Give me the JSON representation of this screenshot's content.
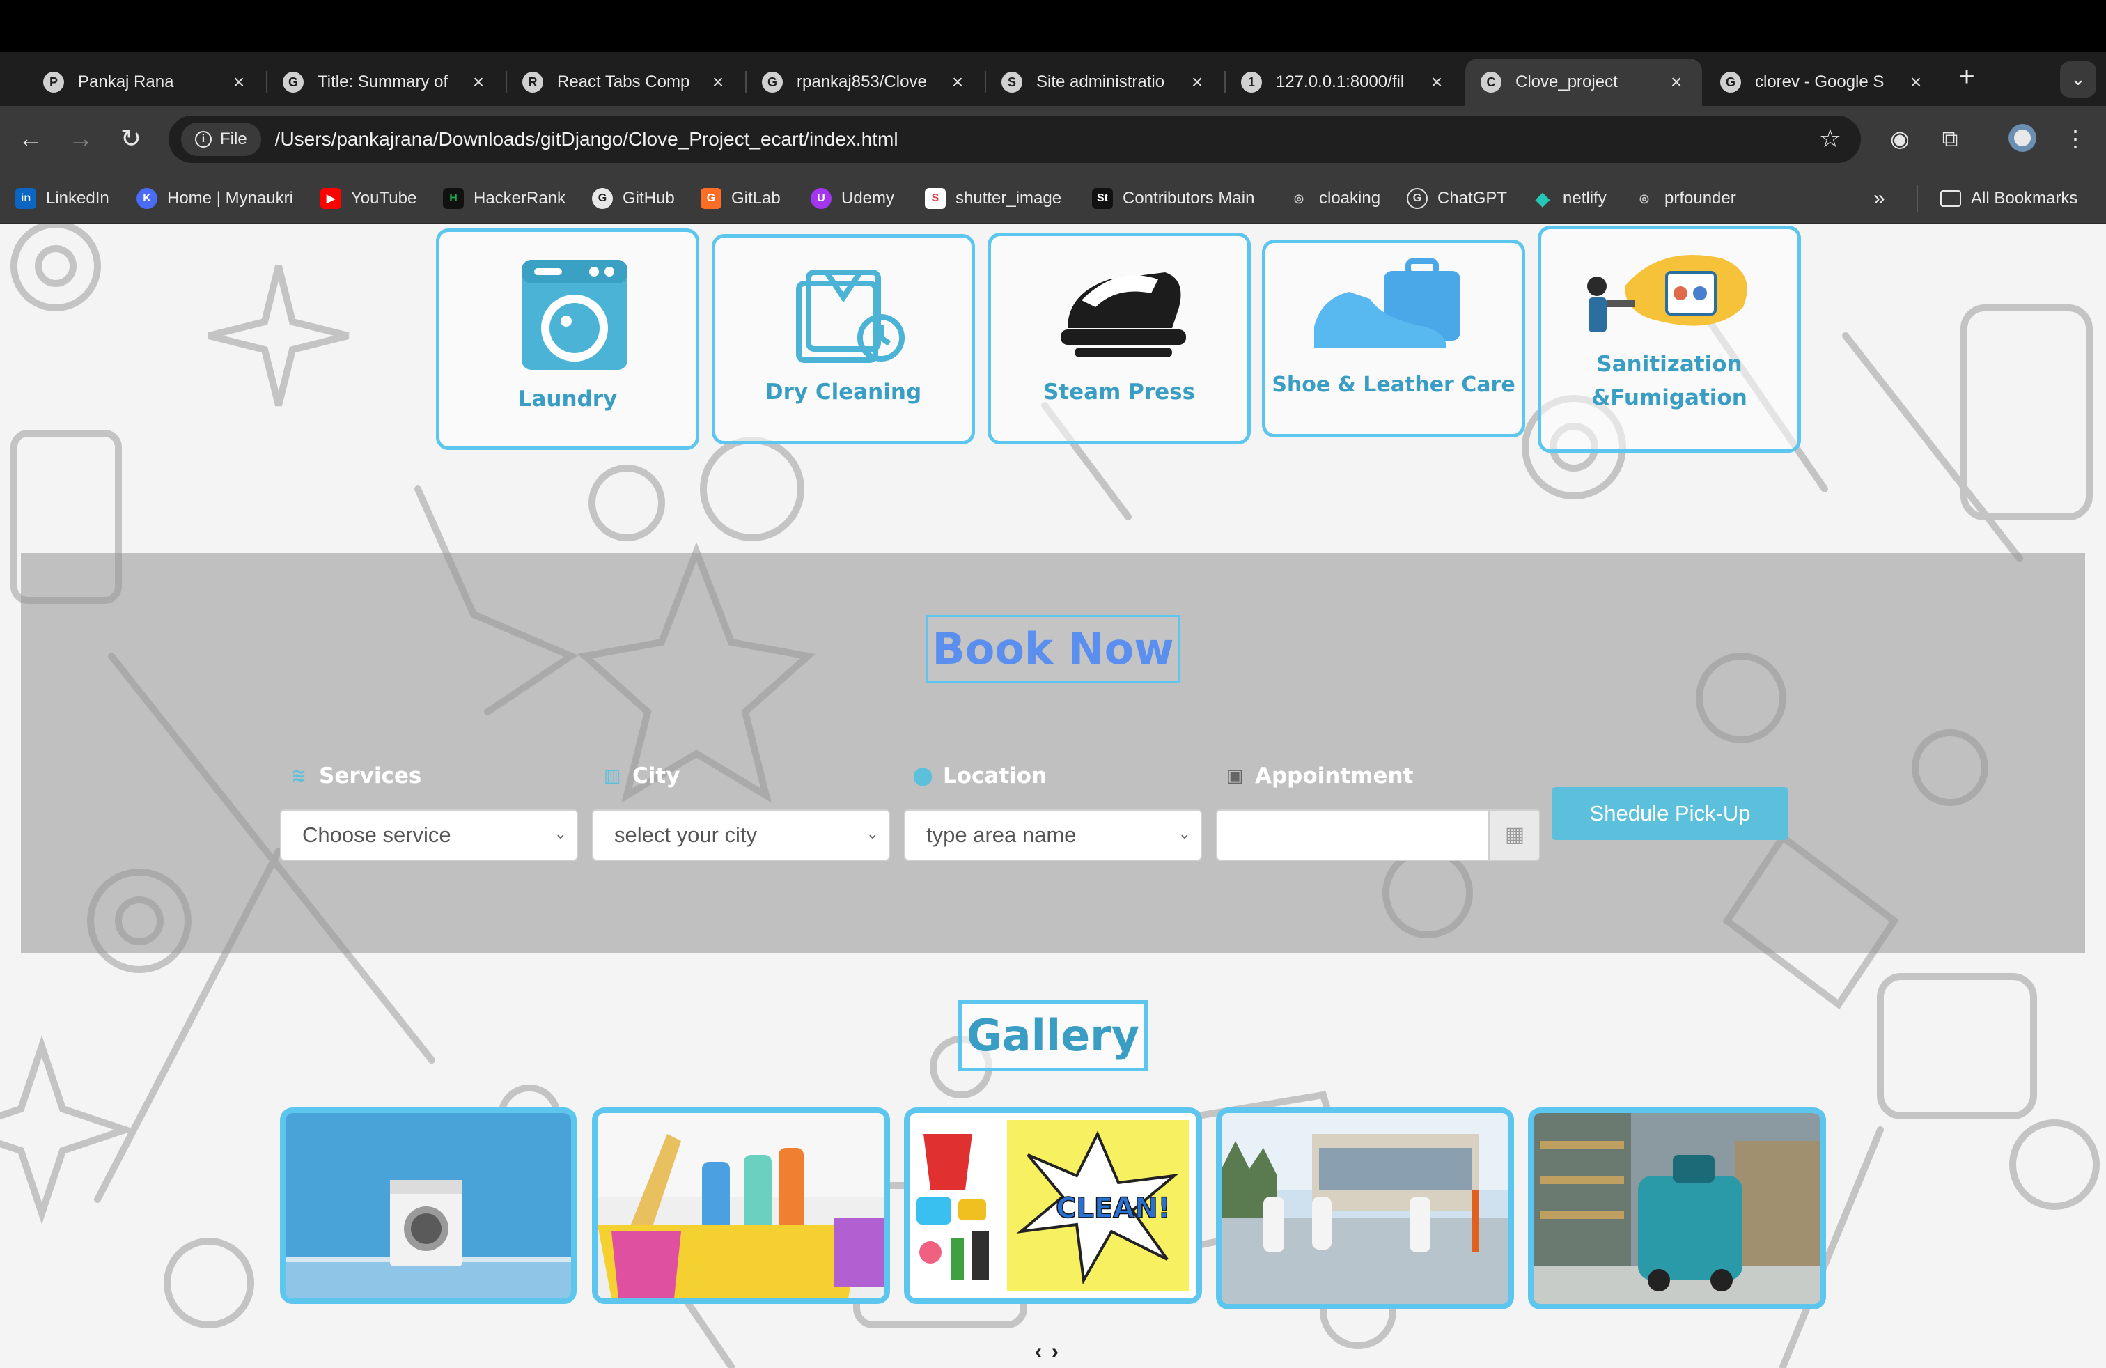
{
  "browser": {
    "tabs": [
      {
        "title": "Pankaj Rana",
        "favicon": "P"
      },
      {
        "title": "Title: Summary of",
        "favicon": "G"
      },
      {
        "title": "React Tabs Comp",
        "favicon": "R"
      },
      {
        "title": "rpankaj853/Clove",
        "favicon": "G"
      },
      {
        "title": "Site administratio",
        "favicon": "S"
      },
      {
        "title": "127.0.0.1:8000/fil",
        "favicon": "1"
      },
      {
        "title": "Clove_project",
        "favicon": "C"
      },
      {
        "title": "clorev - Google S",
        "favicon": "G"
      }
    ],
    "active_tab_index": 6,
    "new_tab_label": "+",
    "tab_menu_label": "⌄",
    "address": {
      "chip_label": "File",
      "url": "/Users/pankajrana/Downloads/gitDjango/Clove_Project_ecart/index.html"
    },
    "bookmarks": [
      {
        "label": "LinkedIn",
        "icon": "in",
        "color": "#0a66c2"
      },
      {
        "label": "Home | Mynaukri",
        "icon": "K",
        "color": "#4a6cf7"
      },
      {
        "label": "YouTube",
        "icon": "▶",
        "color": "#ff0000"
      },
      {
        "label": "HackerRank",
        "icon": "H",
        "color": "#1ba94c"
      },
      {
        "label": "GitHub",
        "icon": "G",
        "color": "#555555"
      },
      {
        "label": "GitLab",
        "icon": "G",
        "color": "#fc6d26"
      },
      {
        "label": "Udemy",
        "icon": "U",
        "color": "#a435f0"
      },
      {
        "label": "shutter_image",
        "icon": "S",
        "color": "#e0434d"
      },
      {
        "label": "Contributors Main",
        "icon": "St",
        "color": "#111111"
      },
      {
        "label": "cloaking",
        "icon": "◎",
        "color": "#777777"
      },
      {
        "label": "ChatGPT",
        "icon": "G",
        "color": "#555555"
      },
      {
        "label": "netlify",
        "icon": "◆",
        "color": "#25c7b7"
      },
      {
        "label": "prfounder",
        "icon": "◎",
        "color": "#777777"
      }
    ],
    "bookmarks_overflow": "»",
    "all_bookmarks_label": "All Bookmarks"
  },
  "services": [
    {
      "label": "Laundry",
      "icon": "washing-machine-icon"
    },
    {
      "label": "Dry Cleaning",
      "icon": "dry-cleaning-icon"
    },
    {
      "label": "Steam Press",
      "icon": "steam-press-icon"
    },
    {
      "label": "Shoe & Leather Care",
      "icon": "shoe-leather-icon"
    },
    {
      "label": "Sanitization",
      "label2": "&Fumigation",
      "icon": "sanitization-icon"
    }
  ],
  "booking": {
    "title": "Book Now",
    "fields": [
      {
        "label": "Services",
        "icon": "layers-icon",
        "value": "Choose service"
      },
      {
        "label": "City",
        "icon": "city-icon",
        "value": "select your city"
      },
      {
        "label": "Location",
        "icon": "location-pin-icon",
        "value": "type area name"
      },
      {
        "label": "Appointment",
        "icon": "calendar-check-icon",
        "value": ""
      }
    ],
    "submit_label": "Shedule Pick-Up"
  },
  "gallery": {
    "title": "Gallery",
    "images": [
      {
        "name": "washing-machine-photo"
      },
      {
        "name": "cleaning-supplies-photo"
      },
      {
        "name": "clean-cartoon-photo"
      },
      {
        "name": "sanitization-workers-photo"
      },
      {
        "name": "floor-scrubber-photo"
      }
    ],
    "prev_label": "‹",
    "next_label": "›"
  },
  "colors": {
    "accent": "#5cc6ee",
    "label_blue": "#3a9ec4",
    "book_now_blue": "#5a8ff0",
    "button": "#5cc0dc"
  }
}
